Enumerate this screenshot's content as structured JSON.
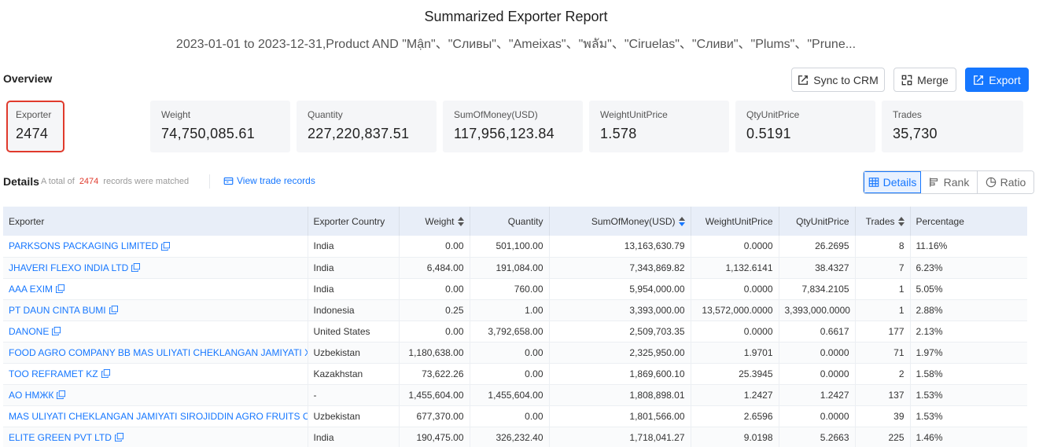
{
  "header": {
    "title": "Summarized Exporter Report",
    "subtitle": "2023-01-01 to 2023-12-31,Product AND \"Mận\"、\"Сливы\"、\"Ameixas\"、\"พลัม\"、\"Ciruelas\"、\"Сливи\"、\"Plums\"、\"Prune..."
  },
  "overview": {
    "label": "Overview",
    "buttons": {
      "sync": "Sync to CRM",
      "merge": "Merge",
      "export": "Export"
    },
    "stats": [
      {
        "label": "Exporter",
        "value": "2474"
      },
      {
        "label": "Weight",
        "value": "74,750,085.61"
      },
      {
        "label": "Quantity",
        "value": "227,220,837.51"
      },
      {
        "label": "SumOfMoney(USD)",
        "value": "117,956,123.84"
      },
      {
        "label": "WeightUnitPrice",
        "value": "1.578"
      },
      {
        "label": "QtyUnitPrice",
        "value": "0.5191"
      },
      {
        "label": "Trades",
        "value": "35,730"
      }
    ]
  },
  "details": {
    "label": "Details",
    "prefix": "A total of",
    "count": "2474",
    "suffix": "records were matched",
    "view_link": "View trade records",
    "tabs": {
      "details": "Details",
      "rank": "Rank",
      "ratio": "Ratio"
    }
  },
  "table": {
    "columns": [
      "Exporter",
      "Exporter Country",
      "Weight",
      "Quantity",
      "SumOfMoney(USD)",
      "WeightUnitPrice",
      "QtyUnitPrice",
      "Trades",
      "Percentage"
    ],
    "rows": [
      [
        "PARKSONS PACKAGING LIMITED",
        "India",
        "0.00",
        "501,100.00",
        "13,163,630.79",
        "0.0000",
        "26.2695",
        "8",
        "11.16%"
      ],
      [
        "JHAVERI FLEXO INDIA LTD",
        "India",
        "6,484.00",
        "191,084.00",
        "7,343,869.82",
        "1,132.6141",
        "38.4327",
        "7",
        "6.23%"
      ],
      [
        "AAA EXIM",
        "India",
        "0.00",
        "760.00",
        "5,954,000.00",
        "0.0000",
        "7,834.2105",
        "1",
        "5.05%"
      ],
      [
        "PT DAUN CINTA BUMI",
        "Indonesia",
        "0.25",
        "1.00",
        "3,393,000.00",
        "13,572,000.0000",
        "3,393,000.0000",
        "1",
        "2.88%"
      ],
      [
        "DANONE",
        "United States",
        "0.00",
        "3,792,658.00",
        "2,509,703.35",
        "0.0000",
        "0.6617",
        "177",
        "2.13%"
      ],
      [
        "FOOD AGRO COMPANY BB MAS ULIYATI CHEKLANGAN JAMIYATI X",
        "Uzbekistan",
        "1,180,638.00",
        "0.00",
        "2,325,950.00",
        "1.9701",
        "0.0000",
        "71",
        "1.97%"
      ],
      [
        "TOO REFRAMET KZ",
        "Kazakhstan",
        "73,622.26",
        "0.00",
        "1,869,600.10",
        "25.3945",
        "0.0000",
        "2",
        "1.58%"
      ],
      [
        "AO НМЖК",
        "-",
        "1,455,604.00",
        "1,455,604.00",
        "1,808,898.01",
        "1.2427",
        "1.2427",
        "137",
        "1.53%"
      ],
      [
        "MAS ULIYATI CHEKLANGAN JAMIYATI SIROJIDDIN AGRO FRUITS C",
        "Uzbekistan",
        "677,370.00",
        "0.00",
        "1,801,566.00",
        "2.6596",
        "0.0000",
        "39",
        "1.53%"
      ],
      [
        "ELITE GREEN PVT LTD",
        "India",
        "190,475.00",
        "326,232.40",
        "1,718,041.27",
        "9.0198",
        "5.2663",
        "225",
        "1.46%"
      ]
    ]
  }
}
